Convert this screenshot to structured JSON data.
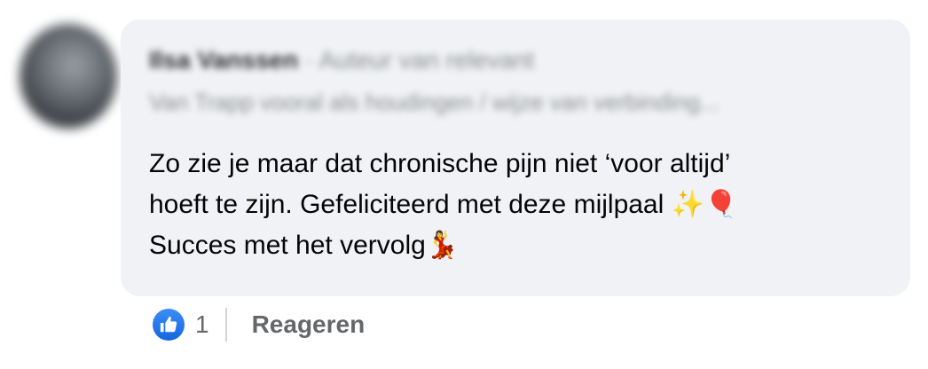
{
  "comment": {
    "author_name": "Ilsa Vanssen",
    "author_meta": "· Auteur van relevant",
    "author_subline": "Van Trapp vooral als houdingen / wijze van verbinding...",
    "body_lines": [
      "Zo zie je maar dat chronische pijn niet ‘voor altijd’",
      "hoeft te zijn. Gefeliciteerd met deze mijlpaal ✨🎈",
      "Succes met het vervolg💃"
    ]
  },
  "footer": {
    "like_icon": "thumbs-up-icon",
    "like_count": "1",
    "reply_label": "Reageren"
  },
  "colors": {
    "bubble_bg": "#f0f2f5",
    "like_blue": "#1877f2",
    "meta_gray": "#65676b"
  }
}
